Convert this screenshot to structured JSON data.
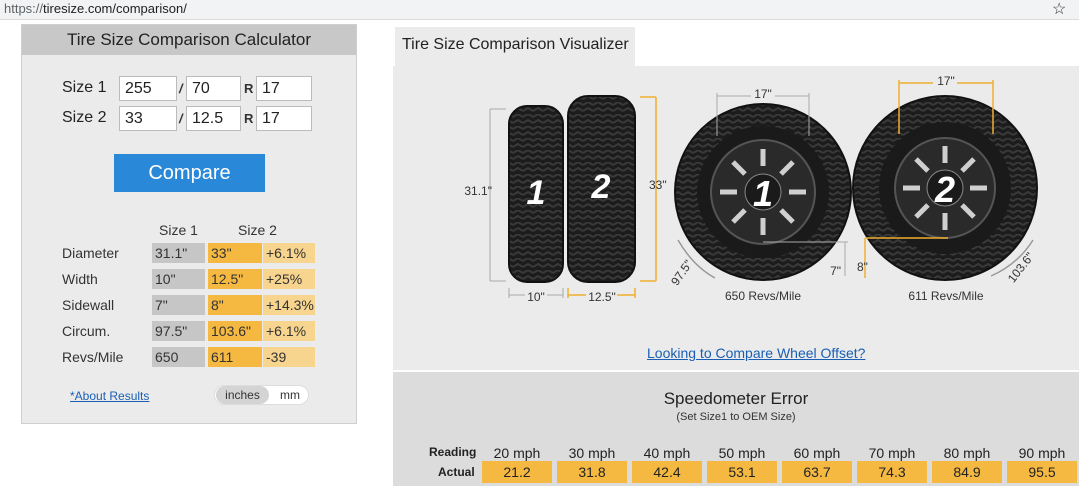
{
  "browser": {
    "url_proto": "https://",
    "url_rest": "tiresize.com/comparison/"
  },
  "calculator": {
    "title": "Tire Size Comparison Calculator",
    "size1": {
      "label": "Size 1",
      "width": "255",
      "aspect": "70",
      "rim": "17"
    },
    "size2": {
      "label": "Size 2",
      "width": "33",
      "aspect": "12.5",
      "rim": "17"
    },
    "slash": "/",
    "r_label": "R",
    "compare_label": "Compare",
    "results": {
      "col_size1": "Size 1",
      "col_size2": "Size 2",
      "rows": [
        {
          "label": "Diameter",
          "s1": "31.1\"",
          "s2": "33\"",
          "diff": "+6.1%"
        },
        {
          "label": "Width",
          "s1": "10\"",
          "s2": "12.5\"",
          "diff": "+25%"
        },
        {
          "label": "Sidewall",
          "s1": "7\"",
          "s2": "8\"",
          "diff": "+14.3%"
        },
        {
          "label": "Circum.",
          "s1": "97.5\"",
          "s2": "103.6\"",
          "diff": "+6.1%"
        },
        {
          "label": "Revs/Mile",
          "s1": "650",
          "s2": "611",
          "diff": "-39"
        }
      ]
    },
    "about_link": "*About Results",
    "units": {
      "selected": "inches",
      "other": "mm"
    }
  },
  "visualizer": {
    "tab_label": "Tire Size Comparison Visualizer",
    "tire1": {
      "number": "1",
      "diameter": "31.1\"",
      "width": "10\"",
      "rim": "17\"",
      "circum": "97.5\"",
      "sidewall": "7\"",
      "revs": "650 Revs/Mile"
    },
    "tire2": {
      "number": "2",
      "diameter": "33\"",
      "width": "12.5\"",
      "rim": "17\"",
      "circum": "103.6\"",
      "sidewall": "8\"",
      "revs": "611 Revs/Mile"
    },
    "wheel_offset_link": "Looking to Compare Wheel Offset?",
    "colors": {
      "tire1_dim": "#aaaaaa",
      "tire2_dim": "#f0b030"
    }
  },
  "speedometer": {
    "title": "Speedometer Error",
    "subtitle": "(Set Size1 to OEM Size)",
    "reading_label": "Reading",
    "actual_label": "Actual",
    "readings": [
      "20 mph",
      "30 mph",
      "40 mph",
      "50 mph",
      "60 mph",
      "70 mph",
      "80 mph",
      "90 mph"
    ],
    "actuals": [
      "21.2",
      "31.8",
      "42.4",
      "53.1",
      "63.7",
      "74.3",
      "84.9",
      "95.5"
    ]
  }
}
